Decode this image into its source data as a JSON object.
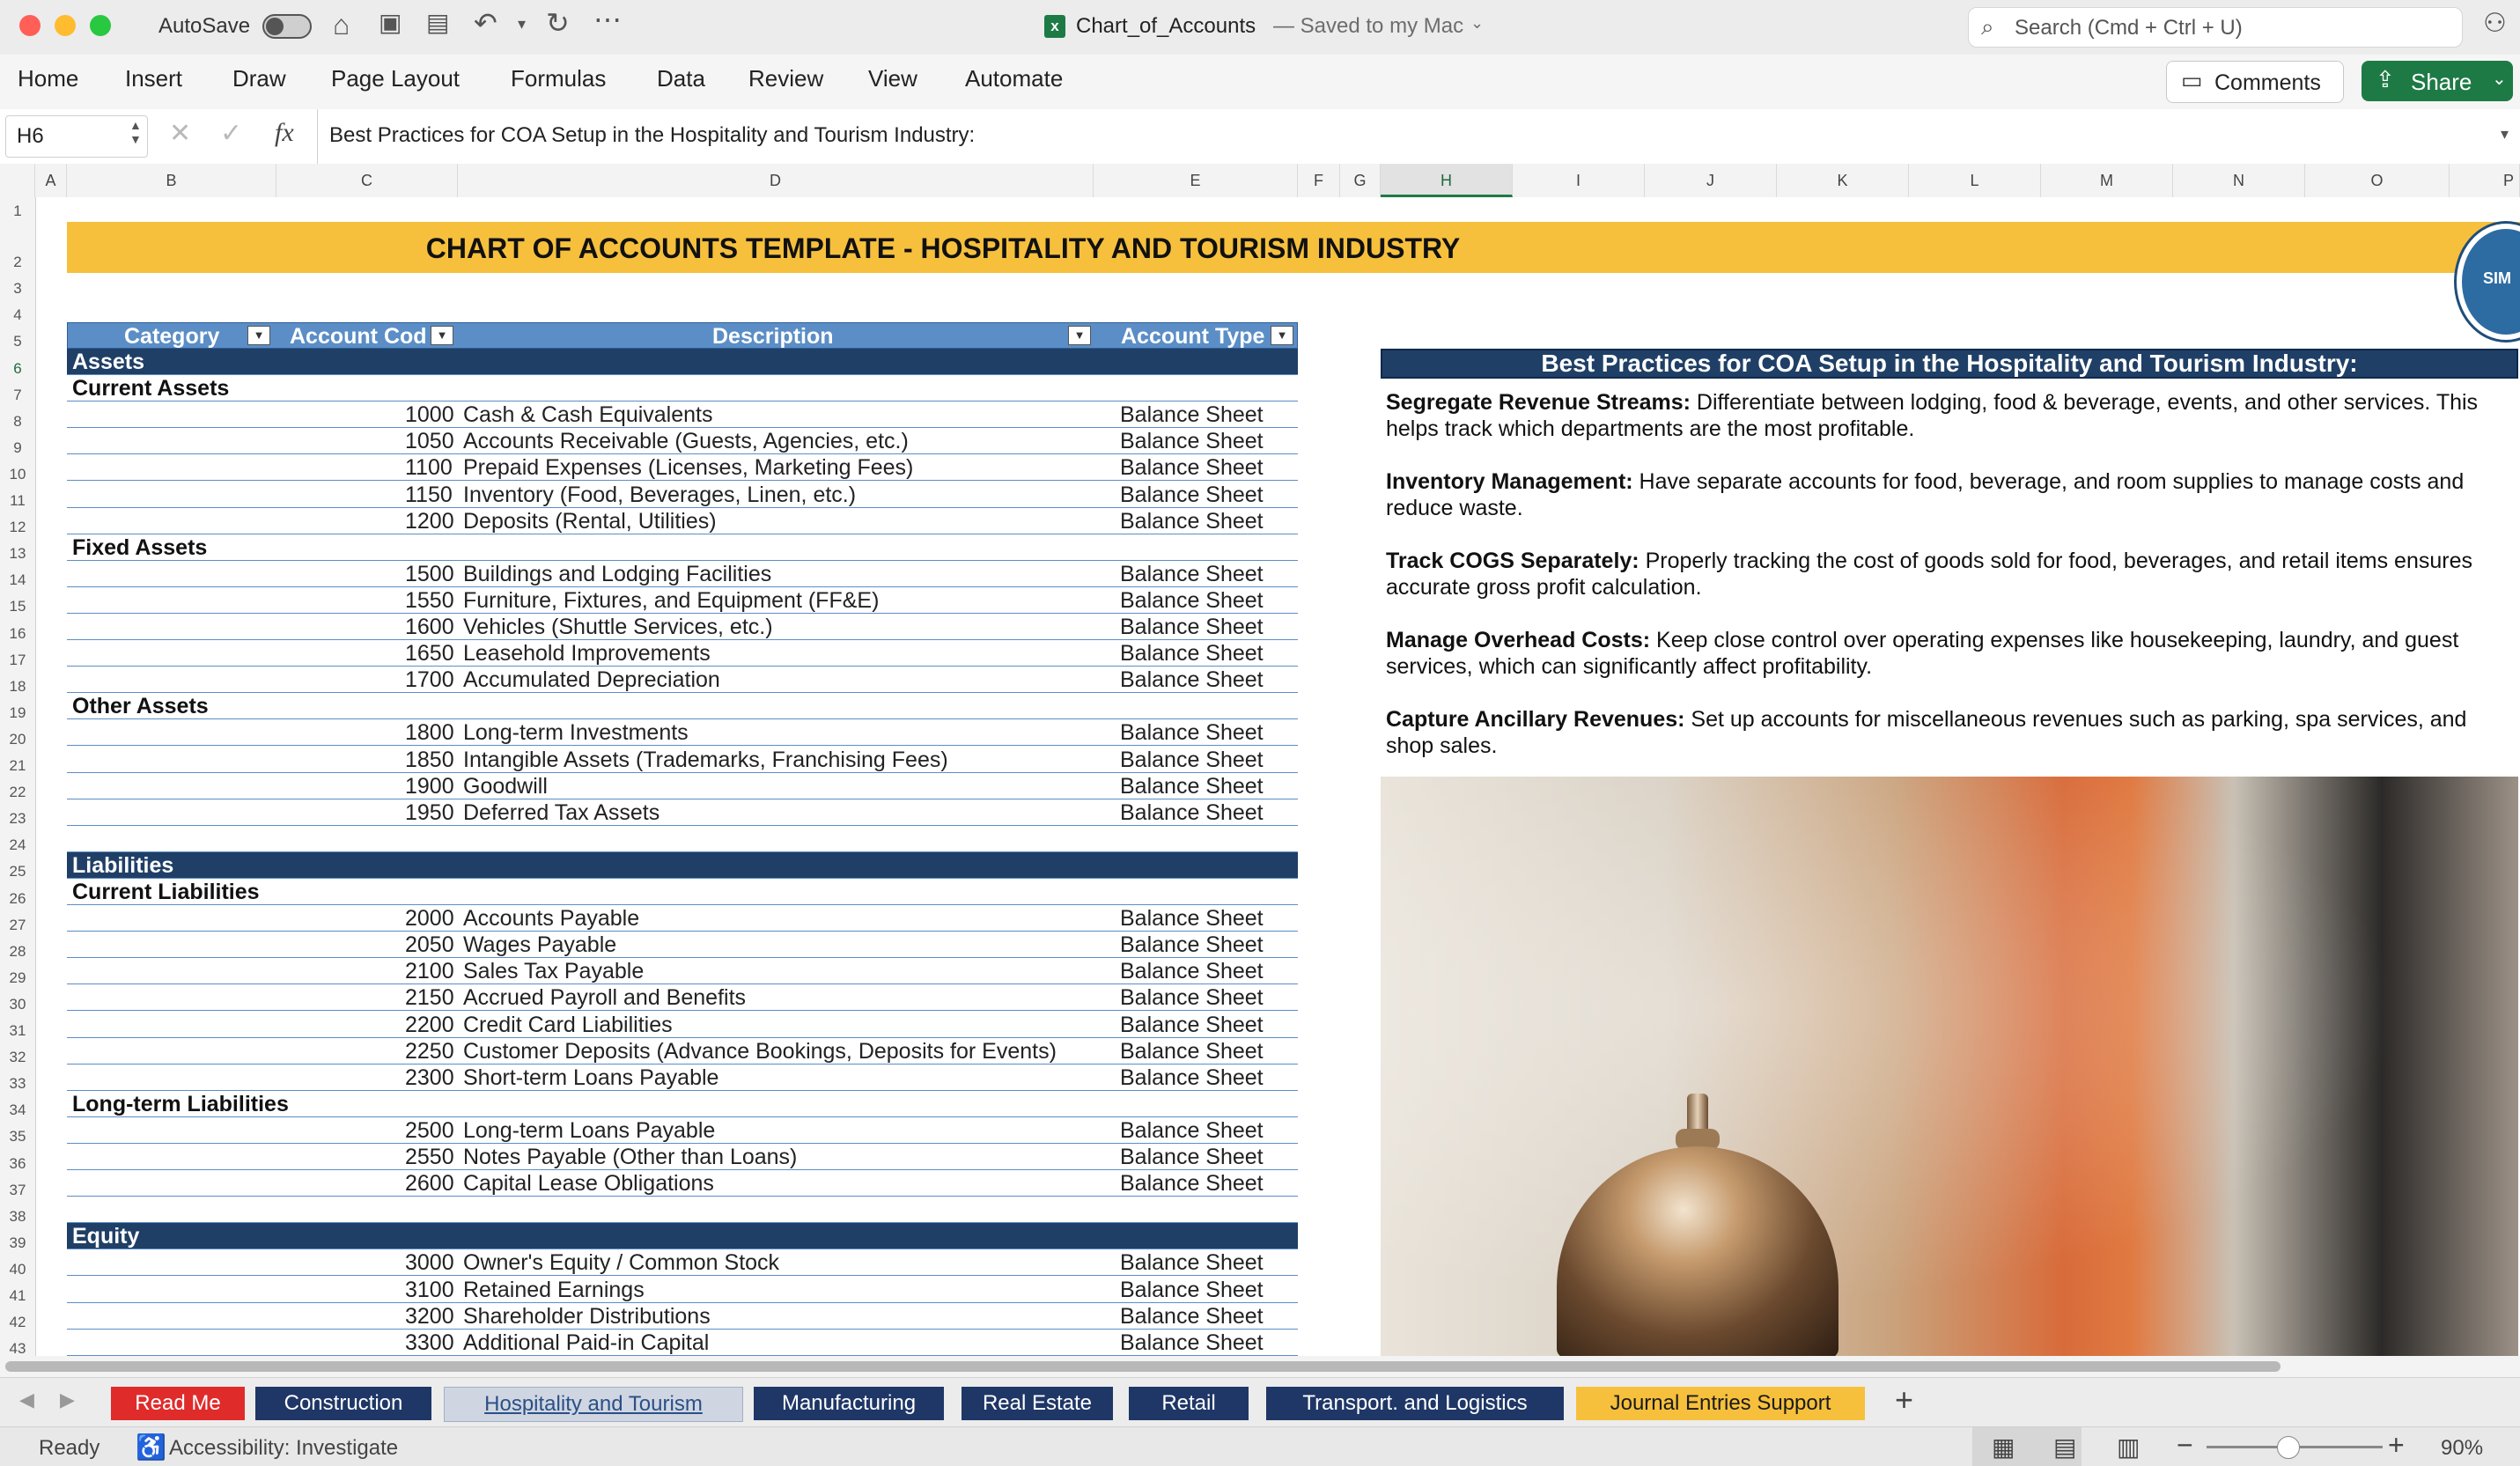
{
  "titlebar": {
    "autosave_label": "AutoSave",
    "file_name": "Chart_of_Accounts",
    "saved_status": "— Saved to my Mac",
    "search_placeholder": "Search (Cmd + Ctrl + U)"
  },
  "ribbon": {
    "menus": [
      "Home",
      "Insert",
      "Draw",
      "Page Layout",
      "Formulas",
      "Data",
      "Review",
      "View",
      "Automate"
    ],
    "comments_label": "Comments",
    "share_label": "Share"
  },
  "formula_bar": {
    "cell_ref": "H6",
    "fx_label": "fx",
    "content": "Best Practices for COA Setup in the Hospitality and Tourism Industry:"
  },
  "columns": [
    "A",
    "B",
    "C",
    "D",
    "E",
    "F",
    "G",
    "H",
    "I",
    "J",
    "K",
    "L",
    "M",
    "N",
    "O",
    "P"
  ],
  "rows": [
    "1",
    "2",
    "3",
    "4",
    "5",
    "6",
    "7",
    "8",
    "9",
    "10",
    "11",
    "12",
    "13",
    "14",
    "15",
    "16",
    "17",
    "18",
    "19",
    "20",
    "21",
    "22",
    "23",
    "24",
    "25",
    "26",
    "27",
    "28",
    "29",
    "30",
    "31",
    "32",
    "33",
    "34",
    "35",
    "36",
    "37",
    "38",
    "39",
    "40",
    "41",
    "42",
    "43"
  ],
  "sheet_title": "CHART OF ACCOUNTS TEMPLATE - HOSPITALITY AND TOURISM INDUSTRY",
  "logo_text": "SIM",
  "table": {
    "headers": [
      "Category",
      "Account Cod",
      "Description",
      "Account Type"
    ],
    "rows": [
      {
        "type": "section",
        "label": "Assets"
      },
      {
        "type": "sub",
        "label": "Current Assets"
      },
      {
        "code": "1000",
        "desc": "Cash & Cash Equivalents",
        "acct": "Balance Sheet"
      },
      {
        "code": "1050",
        "desc": "Accounts Receivable (Guests, Agencies, etc.)",
        "acct": "Balance Sheet"
      },
      {
        "code": "1100",
        "desc": "Prepaid Expenses (Licenses, Marketing Fees)",
        "acct": "Balance Sheet"
      },
      {
        "code": "1150",
        "desc": "Inventory (Food, Beverages, Linen, etc.)",
        "acct": "Balance Sheet"
      },
      {
        "code": "1200",
        "desc": "Deposits (Rental, Utilities)",
        "acct": "Balance Sheet"
      },
      {
        "type": "sub",
        "label": "Fixed Assets"
      },
      {
        "code": "1500",
        "desc": "Buildings and Lodging Facilities",
        "acct": "Balance Sheet"
      },
      {
        "code": "1550",
        "desc": "Furniture, Fixtures, and Equipment (FF&E)",
        "acct": "Balance Sheet"
      },
      {
        "code": "1600",
        "desc": "Vehicles (Shuttle Services, etc.)",
        "acct": "Balance Sheet"
      },
      {
        "code": "1650",
        "desc": "Leasehold Improvements",
        "acct": "Balance Sheet"
      },
      {
        "code": "1700",
        "desc": "Accumulated Depreciation",
        "acct": "Balance Sheet"
      },
      {
        "type": "sub",
        "label": "Other Assets"
      },
      {
        "code": "1800",
        "desc": "Long-term Investments",
        "acct": "Balance Sheet"
      },
      {
        "code": "1850",
        "desc": "Intangible Assets (Trademarks, Franchising Fees)",
        "acct": "Balance Sheet"
      },
      {
        "code": "1900",
        "desc": "Goodwill",
        "acct": "Balance Sheet"
      },
      {
        "code": "1950",
        "desc": "Deferred Tax Assets",
        "acct": "Balance Sheet"
      },
      {
        "type": "blank"
      },
      {
        "type": "section",
        "label": "Liabilities"
      },
      {
        "type": "sub",
        "label": "Current Liabilities"
      },
      {
        "code": "2000",
        "desc": "Accounts Payable",
        "acct": "Balance Sheet"
      },
      {
        "code": "2050",
        "desc": "Wages Payable",
        "acct": "Balance Sheet"
      },
      {
        "code": "2100",
        "desc": "Sales Tax Payable",
        "acct": "Balance Sheet"
      },
      {
        "code": "2150",
        "desc": "Accrued Payroll and Benefits",
        "acct": "Balance Sheet"
      },
      {
        "code": "2200",
        "desc": "Credit Card Liabilities",
        "acct": "Balance Sheet"
      },
      {
        "code": "2250",
        "desc": "Customer Deposits (Advance Bookings, Deposits for Events)",
        "acct": "Balance Sheet"
      },
      {
        "code": "2300",
        "desc": "Short-term Loans Payable",
        "acct": "Balance Sheet"
      },
      {
        "type": "sub",
        "label": "Long-term Liabilities"
      },
      {
        "code": "2500",
        "desc": "Long-term Loans Payable",
        "acct": "Balance Sheet"
      },
      {
        "code": "2550",
        "desc": "Notes Payable (Other than Loans)",
        "acct": "Balance Sheet"
      },
      {
        "code": "2600",
        "desc": "Capital Lease Obligations",
        "acct": "Balance Sheet"
      },
      {
        "type": "blank"
      },
      {
        "type": "section",
        "label": "Equity"
      },
      {
        "code": "3000",
        "desc": "Owner's Equity / Common Stock",
        "acct": "Balance Sheet"
      },
      {
        "code": "3100",
        "desc": "Retained Earnings",
        "acct": "Balance Sheet"
      },
      {
        "code": "3200",
        "desc": "Shareholder Distributions",
        "acct": "Balance Sheet"
      },
      {
        "code": "3300",
        "desc": "Additional Paid-in Capital",
        "acct": "Balance Sheet"
      }
    ]
  },
  "best_practices": {
    "heading": "Best Practices for COA Setup in the Hospitality and Tourism Industry:",
    "items": [
      {
        "title": "Segregate Revenue Streams:",
        "text": " Differentiate between lodging, food & beverage, events, and other services. This helps track which departments are the most profitable."
      },
      {
        "title": "Inventory Management:",
        "text": " Have separate accounts for food, beverage, and room supplies to manage costs and reduce waste."
      },
      {
        "title": "Track COGS Separately:",
        "text": " Properly tracking the cost of goods sold for food, beverages, and retail items ensures accurate gross profit calculation."
      },
      {
        "title": "Manage Overhead Costs:",
        "text": " Keep close control over operating expenses like housekeeping, laundry, and guest services, which can significantly affect profitability."
      },
      {
        "title": "Capture Ancillary Revenues:",
        "text": " Set up accounts for miscellaneous revenues such as parking, spa services, and shop sales."
      }
    ]
  },
  "sheet_tabs": [
    {
      "label": "Read Me",
      "color": "#e02b2b",
      "text": "#ffffff",
      "active": false
    },
    {
      "label": "Construction",
      "color": "#1f3766",
      "text": "#ffffff",
      "active": false
    },
    {
      "label": "Hospitality and Tourism",
      "color": "#cfd6e2",
      "text": "#2b4f86",
      "active": true
    },
    {
      "label": "Manufacturing",
      "color": "#1f3766",
      "text": "#ffffff",
      "active": false
    },
    {
      "label": "Real Estate",
      "color": "#1f3766",
      "text": "#ffffff",
      "active": false
    },
    {
      "label": "Retail",
      "color": "#1f3766",
      "text": "#ffffff",
      "active": false
    },
    {
      "label": "Transport. and Logistics",
      "color": "#1f3766",
      "text": "#ffffff",
      "active": false
    },
    {
      "label": "Journal Entries Support",
      "color": "#f6c03d",
      "text": "#1a1a1a",
      "active": false
    }
  ],
  "add_sheet_label": "+",
  "status": {
    "ready": "Ready",
    "accessibility": "Accessibility: Investigate",
    "zoom": "90%"
  },
  "colors": {
    "banner": "#f6c03d",
    "section_fill": "#1f3f66",
    "header_fill": "#5b8ec6",
    "share_button": "#1e7a45"
  }
}
